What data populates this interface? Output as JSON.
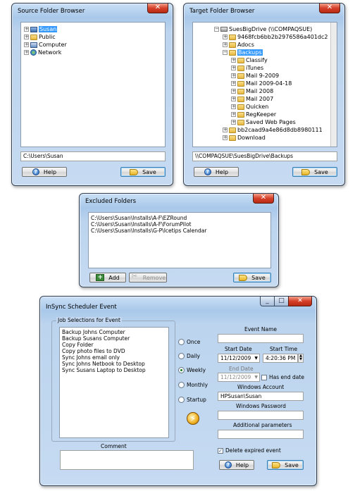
{
  "source_window": {
    "title": "Source Folder Browser",
    "tree": [
      {
        "label": "Susan",
        "icon": "user-icon",
        "selected": true
      },
      {
        "label": "Public",
        "icon": "folder-icon",
        "selected": false
      },
      {
        "label": "Computer",
        "icon": "computer-icon",
        "selected": false
      },
      {
        "label": "Network",
        "icon": "network-icon",
        "selected": false
      }
    ],
    "path": "C:\\Users\\Susan",
    "help_label": "Help",
    "save_label": "Save"
  },
  "target_window": {
    "title": "Target Folder Browser",
    "tree_root": "SuesBigDrive (\\\\COMPAQSUE)",
    "tree": [
      {
        "label": "9468fcb6bb2b2976586a401dc2",
        "selected": false,
        "level": 1
      },
      {
        "label": "Adocs",
        "selected": false,
        "level": 1
      },
      {
        "label": "Backups",
        "selected": true,
        "level": 1
      },
      {
        "label": "Classify",
        "selected": false,
        "level": 2
      },
      {
        "label": "iTunes",
        "selected": false,
        "level": 2
      },
      {
        "label": "Mail 9-2009",
        "selected": false,
        "level": 2
      },
      {
        "label": "Mail 2009-04-18",
        "selected": false,
        "level": 2
      },
      {
        "label": "Mail 2008",
        "selected": false,
        "level": 2
      },
      {
        "label": "Mail 2007",
        "selected": false,
        "level": 2
      },
      {
        "label": "Quicken",
        "selected": false,
        "level": 2
      },
      {
        "label": "RegKeeper",
        "selected": false,
        "level": 2
      },
      {
        "label": "Saved Web Pages",
        "selected": false,
        "level": 2
      },
      {
        "label": "bb2caad9a4e86d8db8980111",
        "selected": false,
        "level": 1
      },
      {
        "label": "Download",
        "selected": false,
        "level": 1
      }
    ],
    "path": "\\\\COMPAQSUE\\SuesBigDrive\\Backups",
    "help_label": "Help",
    "save_label": "Save"
  },
  "excluded_window": {
    "title": "Excluded Folders",
    "items": [
      "C:\\Users\\Susan\\Installs\\A-F\\EZRound",
      "C:\\Users\\Susan\\Installs\\A-F\\ForumPilot",
      "C:\\Users\\Susan\\Installs\\G-P\\Icetips Calendar"
    ],
    "add_label": "Add",
    "remove_label": "Remove",
    "save_label": "Save"
  },
  "scheduler_window": {
    "title": "InSync Scheduler Event",
    "job_group_label": "Job Selections for Event",
    "jobs": [
      "Backup Johns Computer",
      "Backup Susans Computer",
      "Copy Folder",
      "Copy photo files to DVD",
      "Sync Johns email only",
      "Sync Johns Netbook to Desktop",
      "Sync Susans Laptop to Desktop"
    ],
    "comment_label": "Comment",
    "comment_value": "",
    "frequency_options": [
      {
        "label": "Once",
        "selected": false
      },
      {
        "label": "Daily",
        "selected": false
      },
      {
        "label": "Weekly",
        "selected": true
      },
      {
        "label": "Monthly",
        "selected": false
      },
      {
        "label": "Startup",
        "selected": false
      }
    ],
    "event_name_label": "Event Name",
    "event_name_value": "",
    "start_date_label": "Start Date",
    "start_date_value": "11/12/2009",
    "start_time_label": "Start Time",
    "start_time_value": "4:20:36 PM",
    "end_date_label": "End Date",
    "end_date_value": "11/12/2009",
    "has_end_date_label": "Has end date",
    "has_end_date_checked": false,
    "windows_account_label": "Windows Account",
    "windows_account_value": "HPSusan\\Susan",
    "windows_password_label": "Windows Password",
    "windows_password_value": "",
    "additional_params_label": "Additional parameters",
    "additional_params_value": "",
    "delete_expired_label": "Delete expired event",
    "delete_expired_checked": true,
    "help_label": "Help",
    "save_label": "Save"
  }
}
